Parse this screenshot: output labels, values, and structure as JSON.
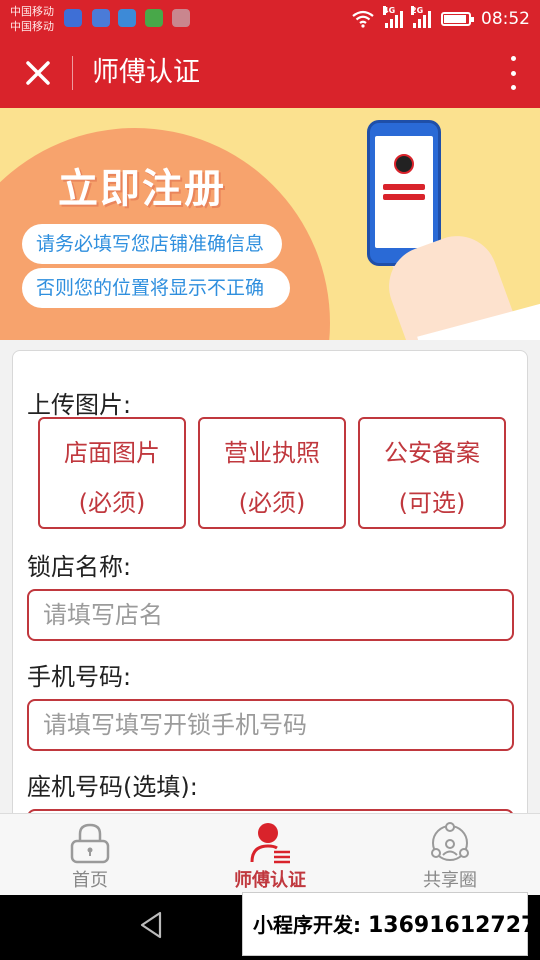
{
  "status_bar": {
    "carrier_1": "中国移动",
    "carrier_2": "中国移动",
    "net_1": "4G",
    "net_2": "2G",
    "battery_level": 0.9,
    "time": "08:52"
  },
  "nav": {
    "title": "师傅认证"
  },
  "banner": {
    "title": "立即注册",
    "line_1": "请务必填写您店铺准确信息",
    "line_2": "否则您的位置将显示不正确"
  },
  "form": {
    "upload_label": "上传图片:",
    "upload_buttons": [
      {
        "line_1": "店面图片",
        "line_2": "(必须)"
      },
      {
        "line_1": "营业执照",
        "line_2": "(必须)"
      },
      {
        "line_1": "公安备案",
        "line_2": "(可选)"
      }
    ],
    "shop_name": {
      "label": "锁店名称:",
      "placeholder": "请填写店名",
      "value": ""
    },
    "mobile": {
      "label": "手机号码:",
      "placeholder": "请填写填写开锁手机号码",
      "value": ""
    },
    "landline": {
      "label": "座机号码(选填):",
      "placeholder": "",
      "value": ""
    }
  },
  "tabbar": {
    "items": [
      {
        "label": "首页",
        "icon": "lock-icon",
        "active": false
      },
      {
        "label": "师傅认证",
        "icon": "user-list-icon",
        "active": true
      },
      {
        "label": "共享圈",
        "icon": "share-circle-icon",
        "active": false
      }
    ]
  },
  "promo": {
    "label": "小程序开发:",
    "phone": "13691612727"
  },
  "colors": {
    "brand_red": "#d9232b",
    "border_red": "#c0383e",
    "banner_yellow": "#fbe18f",
    "banner_orange": "#f7a36d",
    "pill_text_blue": "#2f8fde"
  }
}
